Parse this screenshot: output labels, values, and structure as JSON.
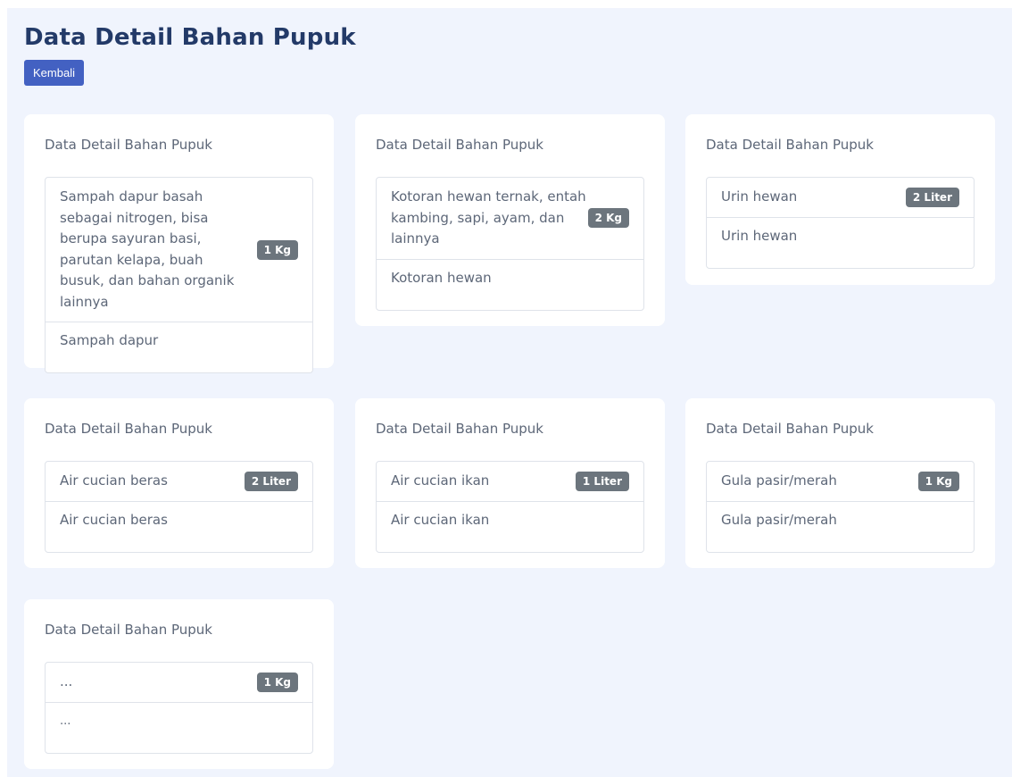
{
  "header": {
    "title": "Data Detail Bahan Pupuk",
    "back_label": "Kembali"
  },
  "cards": [
    {
      "title": "Data Detail Bahan Pupuk",
      "item_name": "Sampah dapur basah sebagai nitrogen, bisa berupa sayuran basi, parutan kelapa, buah busuk, dan bahan organik lainnya",
      "quantity": "1 Kg",
      "description": "Sampah dapur"
    },
    {
      "title": "Data Detail Bahan Pupuk",
      "item_name": "Kotoran hewan ternak, entah kambing, sapi, ayam, dan lainnya",
      "quantity": "2 Kg",
      "description": "Kotoran hewan"
    },
    {
      "title": "Data Detail Bahan Pupuk",
      "item_name": "Urin hewan",
      "quantity": "2 Liter",
      "description": "Urin hewan"
    },
    {
      "title": "Data Detail Bahan Pupuk",
      "item_name": "Air cucian beras",
      "quantity": "2 Liter",
      "description": "Air cucian beras"
    },
    {
      "title": "Data Detail Bahan Pupuk",
      "item_name": "Air cucian ikan",
      "quantity": "1 Liter",
      "description": "Air cucian ikan"
    },
    {
      "title": "Data Detail Bahan Pupuk",
      "item_name": "Gula pasir/merah",
      "quantity": "1 Kg",
      "description": "Gula pasir/merah"
    },
    {
      "title": "Data Detail Bahan Pupuk",
      "item_name": "...",
      "quantity": "1 Kg",
      "description": "..."
    }
  ],
  "colors": {
    "page_background": "#f0f4fd",
    "title": "#233a68",
    "button": "#4361c2",
    "badge": "#6c757d",
    "text": "#5d6778",
    "border": "#dfe3ea"
  }
}
